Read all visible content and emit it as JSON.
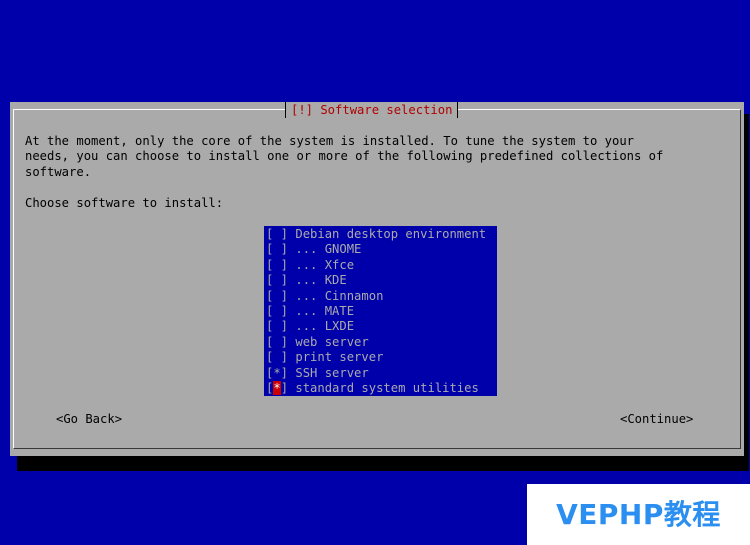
{
  "dialog": {
    "title": "[!] Software selection",
    "description_lines": [
      "At the moment, only the core of the system is installed. To tune the system to your",
      "needs, you can choose to install one or more of the following predefined collections of",
      "software."
    ],
    "prompt": "Choose software to install:",
    "items": [
      {
        "box": "[ ]",
        "label": "Debian desktop environment"
      },
      {
        "box": "[ ]",
        "label": "... GNOME"
      },
      {
        "box": "[ ]",
        "label": "... Xfce"
      },
      {
        "box": "[ ]",
        "label": "... KDE"
      },
      {
        "box": "[ ]",
        "label": "... Cinnamon"
      },
      {
        "box": "[ ]",
        "label": "... MATE"
      },
      {
        "box": "[ ]",
        "label": "... LXDE"
      },
      {
        "box": "[ ]",
        "label": "web server"
      },
      {
        "box": "[ ]",
        "label": "print server"
      },
      {
        "box": "[*]",
        "label": "SSH server"
      },
      {
        "box_open": "[",
        "box_mark": "*",
        "box_close": "]",
        "label": "standard system utilities"
      }
    ],
    "go_back_label": "<Go Back>",
    "continue_label": "<Continue>"
  },
  "watermark": {
    "text": "VEPHP教程"
  },
  "colors": {
    "background": "#0000aa",
    "dialog": "#aaaaaa",
    "title": "#b00000",
    "cursor": "#cc0000",
    "watermark": "#2a8ff0"
  }
}
